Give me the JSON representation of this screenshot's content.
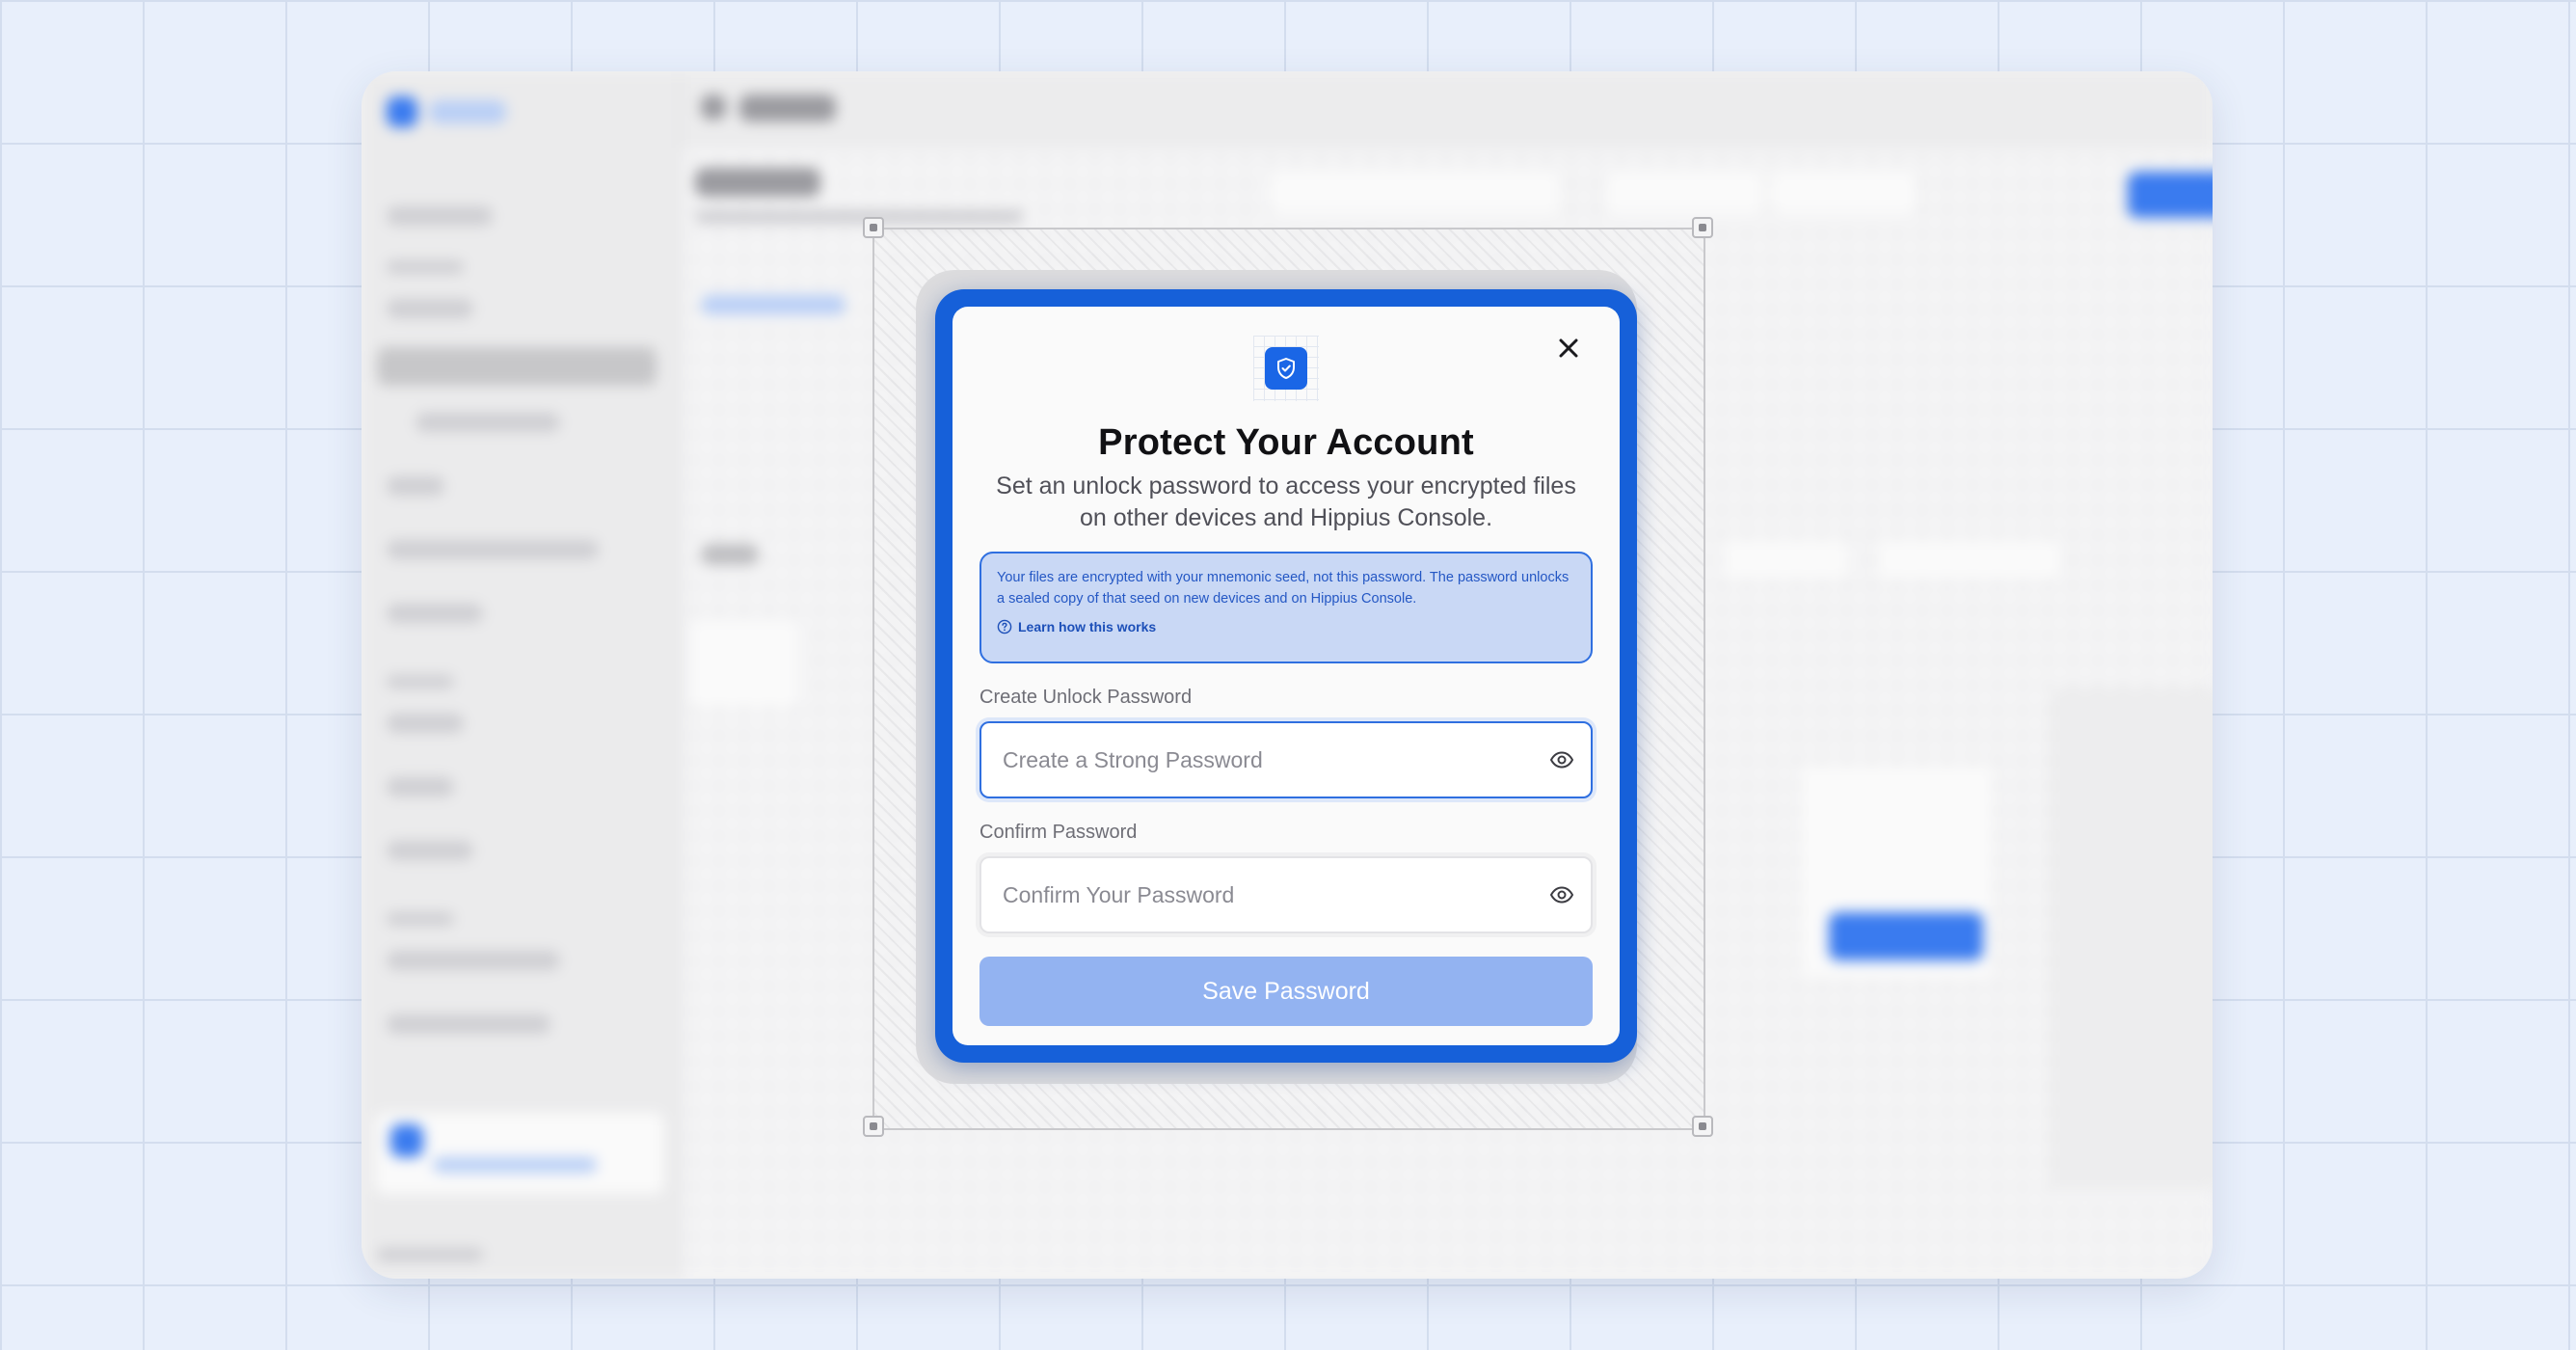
{
  "modal": {
    "title": "Protect Your Account",
    "subtitle": "Set an unlock password to access your encrypted files on other devices and Hippius Console.",
    "info": {
      "text": "Your files are encrypted with your mnemonic seed, not this password. The password unlocks a sealed copy of that seed on new devices and on Hippius Console.",
      "link_label": "Learn how this works"
    },
    "create_password": {
      "label": "Create Unlock Password",
      "placeholder": "Create a Strong Password"
    },
    "confirm_password": {
      "label": "Confirm Password",
      "placeholder": "Confirm Your Password"
    },
    "save_label": "Save Password"
  },
  "colors": {
    "accent": "#1660d9",
    "button_disabled": "#93b3f1",
    "info_bg": "#c9d8f5",
    "info_border": "#2f6fe0"
  },
  "icons": {
    "header": "shield-check-icon",
    "close": "close-icon",
    "info": "question-circle-icon",
    "toggle_visibility": "eye-icon"
  }
}
